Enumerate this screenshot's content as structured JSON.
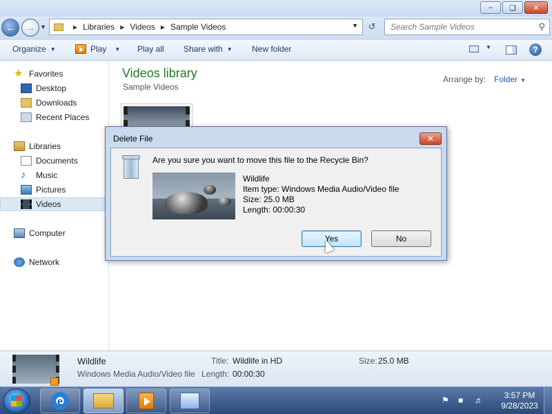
{
  "window": {
    "buttons": {
      "minimize": "–",
      "maximize": "❏",
      "close": "✕"
    }
  },
  "address": {
    "crumbs": [
      "Libraries",
      "Videos",
      "Sample Videos"
    ],
    "search_placeholder": "Search Sample Videos"
  },
  "toolbar": {
    "organize": "Organize",
    "play": "Play",
    "play_all": "Play all",
    "share_with": "Share with",
    "new_folder": "New folder"
  },
  "nav": {
    "favorites": "Favorites",
    "desktop": "Desktop",
    "downloads": "Downloads",
    "recent_places": "Recent Places",
    "libraries": "Libraries",
    "documents": "Documents",
    "music": "Music",
    "pictures": "Pictures",
    "videos": "Videos",
    "computer": "Computer",
    "network": "Network"
  },
  "content": {
    "title": "Videos library",
    "subtitle": "Sample Videos",
    "arrange_label": "Arrange by:",
    "arrange_value": "Folder"
  },
  "dialog": {
    "title": "Delete File",
    "question": "Are you sure you want to move this file to the Recycle Bin?",
    "file_name": "Wildlife",
    "item_type": "Item type: Windows Media Audio/Video file",
    "size": "Size: 25.0 MB",
    "length": "Length: 00:00:30",
    "yes": "Yes",
    "no": "No"
  },
  "details": {
    "name": "Wildlife",
    "type": "Windows Media Audio/Video file",
    "title_label": "Title:",
    "title_value": "Wildlife in HD",
    "length_label": "Length:",
    "length_value": "00:00:30",
    "size_label": "Size:",
    "size_value": "25.0 MB"
  },
  "taskbar": {
    "time": "3:57 PM",
    "date": "9/28/2023"
  }
}
